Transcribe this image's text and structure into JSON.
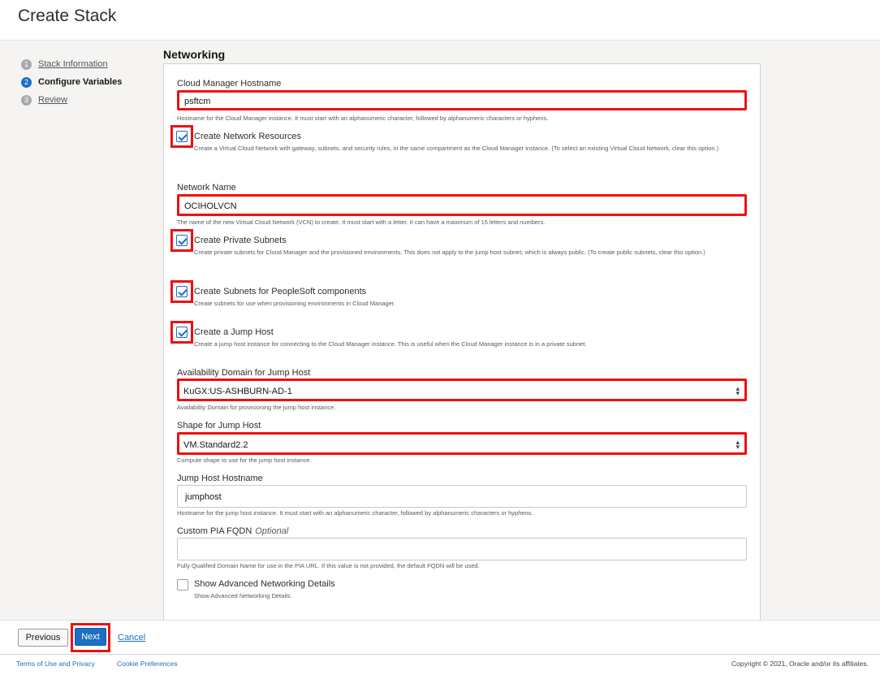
{
  "page": {
    "title": "Create Stack"
  },
  "steps": [
    {
      "num": "1",
      "label": "Stack Information"
    },
    {
      "num": "2",
      "label": "Configure Variables"
    },
    {
      "num": "3",
      "label": "Review"
    }
  ],
  "section": {
    "title": "Networking"
  },
  "fields": {
    "cm_hostname": {
      "label": "Cloud Manager Hostname",
      "value": "psftcm",
      "help": "Hostname for the Cloud Manager instance. It must start with an alphanumeric character, followed by alphanumeric characters or hyphens."
    },
    "create_network": {
      "label": "Create Network Resources",
      "checked": true,
      "help": "Create a Virtual Cloud Network with gateway, subnets, and security rules, in the same compartment as the Cloud Manager instance. (To select an existing Virtual Cloud Network, clear this option.)"
    },
    "network_name": {
      "label": "Network Name",
      "value": "OCIHOLVCN",
      "help": "The name of the new Virtual Cloud Network (VCN) to create. It must start with a letter. It can have a maximum of 15 letters and numbers."
    },
    "private_subnets": {
      "label": "Create Private Subnets",
      "checked": true,
      "help": "Create private subnets for Cloud Manager and the provisioned environments. This does not apply to the jump host subnet, which is always public. (To create public subnets, clear this option.)"
    },
    "psft_subnets": {
      "label": "Create Subnets for PeopleSoft components",
      "checked": true,
      "help": "Create subnets for use when provisioning environments in Cloud Manager."
    },
    "jump_host": {
      "label": "Create a Jump Host",
      "checked": true,
      "help": "Create a jump host instance for connecting to the Cloud Manager instance. This is useful when the Cloud Manager instance is in a private subnet."
    },
    "availability_domain": {
      "label": "Availability Domain for Jump Host",
      "value": "KuGX:US-ASHBURN-AD-1",
      "help": "Availability Domain for provisioning the jump host instance."
    },
    "shape": {
      "label": "Shape for Jump Host",
      "value": "VM.Standard2.2",
      "help": "Compute shape to use for the jump host instance."
    },
    "jump_hostname": {
      "label": "Jump Host Hostname",
      "value": "jumphost",
      "help": "Hostname for the jump host instance. It must start with an alphanumeric character, followed by alphanumeric characters or hyphens."
    },
    "pia_fqdn": {
      "label": "Custom PIA FQDN",
      "optional": "Optional",
      "value": "",
      "help": "Fully Qualified Domain Name for use in the PIA URL. If this value is not provided, the default FQDN will be used."
    },
    "advanced": {
      "label": "Show Advanced Networking Details",
      "checked": false,
      "help": "Show Advanced Networking Details."
    }
  },
  "buttons": {
    "previous": "Previous",
    "next": "Next",
    "cancel": "Cancel"
  },
  "footer": {
    "terms": "Terms of Use and Privacy",
    "cookies": "Cookie Preferences",
    "copyright": "Copyright © 2021, Oracle and/or its affiliates."
  },
  "colors": {
    "accent": "#1b6fc4",
    "highlight": "#ef1010"
  }
}
